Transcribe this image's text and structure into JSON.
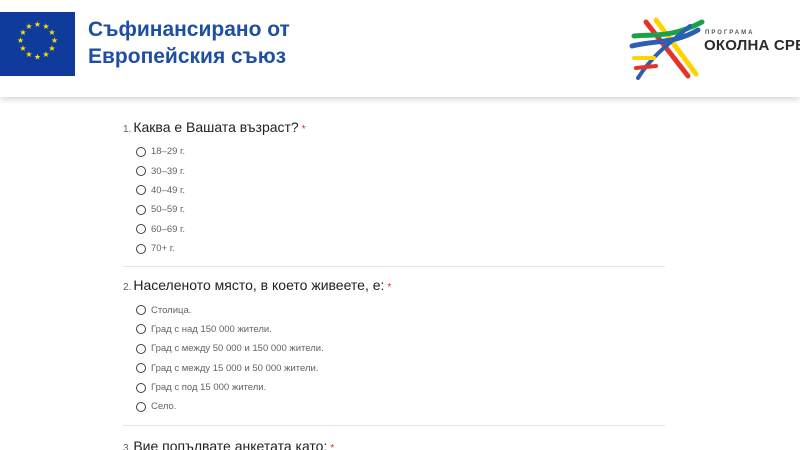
{
  "header": {
    "eu_line1": "Съфинансирано от",
    "eu_line2": "Европейския съюз",
    "program_small": "ПРОГРАМА",
    "program_name": "ОКОЛНА СРЕДА",
    "eu_blue": "#0f3b9c",
    "eu_gold": "#ffdd00",
    "title_color": "#1f4fa3"
  },
  "questions": [
    {
      "number": "1.",
      "title": "Каква е Вашата възраст?",
      "required": "*",
      "options": [
        "18–29 г.",
        "30–39 г.",
        "40–49 г.",
        "50–59 г.",
        "60–69 г.",
        "70+ г."
      ]
    },
    {
      "number": "2.",
      "title": "Населеното място, в което живеете, е:",
      "required": "*",
      "options": [
        "Столица.",
        "Град с над 150 000 жители.",
        "Град с между 50 000 и 150 000 жители.",
        "Град с между 15 000 и 50 000 жители.",
        "Град с под 15 000 жители.",
        "Село."
      ]
    },
    {
      "number": "3.",
      "title": "Вие попълвате анкетата като:",
      "required": "*",
      "options": []
    }
  ]
}
